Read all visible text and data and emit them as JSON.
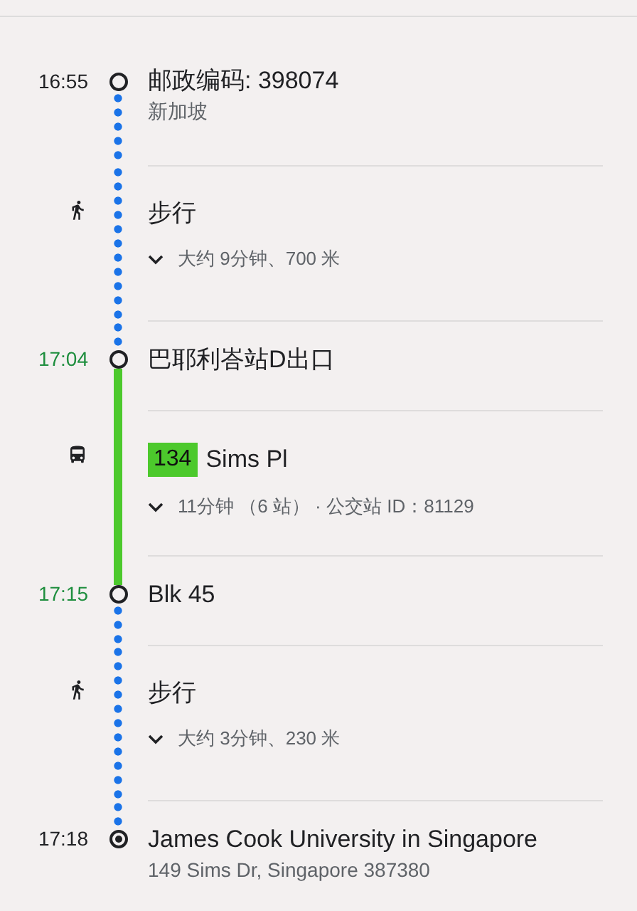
{
  "steps": [
    {
      "kind": "origin",
      "time": "16:55",
      "color": "#202124",
      "title": "邮政编码: 398074",
      "subtitle": "新加坡"
    },
    {
      "kind": "walk",
      "title": "步行",
      "detail": "大约 9分钟、700 米"
    },
    {
      "kind": "stop",
      "time": "17:04",
      "color": "#1e8e3e",
      "title": "巴耶利峇站D出口"
    },
    {
      "kind": "bus",
      "color": "#4cc92c",
      "route": "134",
      "title": "Sims Pl",
      "detail": "11分钟 （6 站） · 公交站 ID：81129"
    },
    {
      "kind": "stop",
      "time": "17:15",
      "color": "#1e8e3e",
      "title": "Blk 45"
    },
    {
      "kind": "walk",
      "title": "步行",
      "detail": "大约 3分钟、230 米"
    },
    {
      "kind": "destination",
      "time": "17:18",
      "color": "#202124",
      "title": "James Cook University in Singapore",
      "subtitle": "149 Sims Dr, Singapore 387380"
    }
  ]
}
